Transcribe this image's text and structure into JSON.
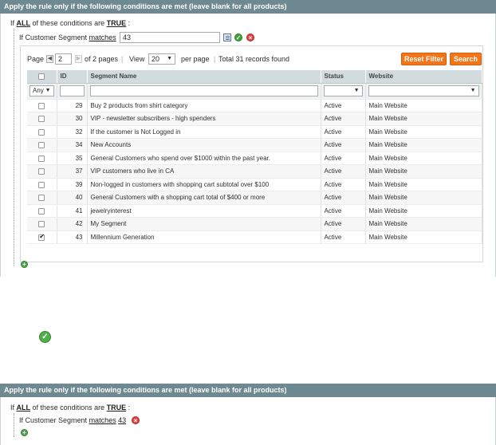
{
  "top_panel": {
    "header": "Apply the rule only if the following conditions are met (leave blank for all products)",
    "cond_if": "If",
    "cond_aggregator": "ALL",
    "cond_middle": "of these conditions are",
    "cond_value": "TRUE",
    "cond_colon": ":",
    "segment_prefix": "If Customer Segment",
    "segment_operator": "matches",
    "segment_value": "43"
  },
  "pager": {
    "page_label": "Page",
    "page_value": "2",
    "of_pages": "of 2 pages",
    "view_label": "View",
    "view_value": "20",
    "per_page": "per page",
    "total": "Total 31 records found",
    "reset_label": "Reset Filter",
    "search_label": "Search"
  },
  "grid": {
    "headers": [
      "",
      "ID",
      "Segment Name",
      "Status",
      "Website"
    ],
    "filter_any": "Any",
    "rows": [
      {
        "id": "29",
        "name": "Buy 2 products from shirt category",
        "status": "Active",
        "website": "Main Website",
        "checked": false
      },
      {
        "id": "30",
        "name": "VIP - newsletter subscribers - high spenders",
        "status": "Active",
        "website": "Main Website",
        "checked": false
      },
      {
        "id": "32",
        "name": "If the customer is Not Logged in",
        "status": "Active",
        "website": "Main Website",
        "checked": false
      },
      {
        "id": "34",
        "name": "New Accounts",
        "status": "Active",
        "website": "Main Website",
        "checked": false
      },
      {
        "id": "35",
        "name": "General Customers who spend over $1000 within the past year.",
        "status": "Active",
        "website": "Main Website",
        "checked": false
      },
      {
        "id": "37",
        "name": "VIP customers who live in CA",
        "status": "Active",
        "website": "Main Website",
        "checked": false
      },
      {
        "id": "39",
        "name": "Non-logged in customers with shopping cart subtotal over $100",
        "status": "Active",
        "website": "Main Website",
        "checked": false
      },
      {
        "id": "40",
        "name": "General Customers with a shopping cart total of $400 or more",
        "status": "Active",
        "website": "Main Website",
        "checked": false
      },
      {
        "id": "41",
        "name": "jewelryinterest",
        "status": "Active",
        "website": "Main Website",
        "checked": false
      },
      {
        "id": "42",
        "name": "My Segment",
        "status": "Active",
        "website": "Main Website",
        "checked": false
      },
      {
        "id": "43",
        "name": "Millennium Generation",
        "status": "Active",
        "website": "Main Website",
        "checked": true
      }
    ]
  },
  "bottom_panel": {
    "header": "Apply the rule only if the following conditions are met (leave blank for all products)",
    "cond_if": "If",
    "cond_aggregator": "ALL",
    "cond_middle": "of these conditions are",
    "cond_value": "TRUE",
    "cond_colon": ":",
    "segment_prefix": "If Customer Segment",
    "segment_operator": "matches",
    "segment_value": "43"
  },
  "icons": {
    "apply": "check-icon",
    "remove": "remove-icon",
    "add": "add-icon",
    "chooser": "list-icon",
    "confirm": "big-check-icon"
  },
  "colors": {
    "header_bg": "#6f8992",
    "button_orange": "#f2751a",
    "grid_header": "#d2dbde"
  }
}
